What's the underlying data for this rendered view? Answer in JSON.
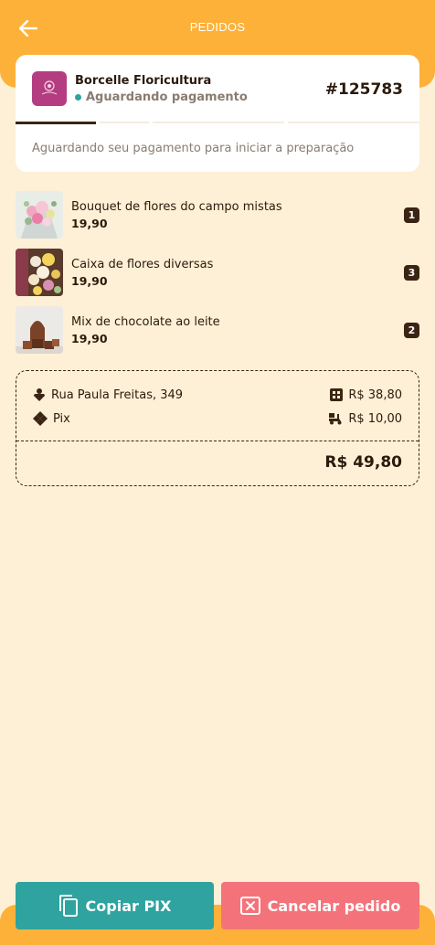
{
  "header": {
    "title": "PEDIDOS",
    "back_icon": "arrow-left-icon"
  },
  "order": {
    "store_name": "Borcelle Floricultura",
    "status": "Aguardando pagamento",
    "status_color": "#2aa59d",
    "order_number": "#125783",
    "message": "Aguardando seu pagamento para iniciar a preparação",
    "progress_steps": 4,
    "progress_current_step": 1
  },
  "items": [
    {
      "name": "Bouquet de flores do campo mistas",
      "price": "19,90",
      "qty": "1"
    },
    {
      "name": "Caixa de flores diversas",
      "price": "19,90",
      "qty": "3"
    },
    {
      "name": "Mix de chocolate ao leite",
      "price": "19,90",
      "qty": "2"
    }
  ],
  "summary": {
    "address": "Rua Paula Freitas, 349",
    "subtotal": "R$ 38,80",
    "payment_method": "Pix",
    "delivery_fee": "R$ 10,00",
    "total": "R$ 49,80"
  },
  "actions": {
    "copy_label": "Copiar PIX",
    "cancel_label": "Cancelar pedido"
  },
  "colors": {
    "accent": "#fdb138",
    "background": "#fdf0d6",
    "primary_button": "#2ea39f",
    "danger_button": "#f4737a",
    "text_dark": "#3b2413"
  }
}
